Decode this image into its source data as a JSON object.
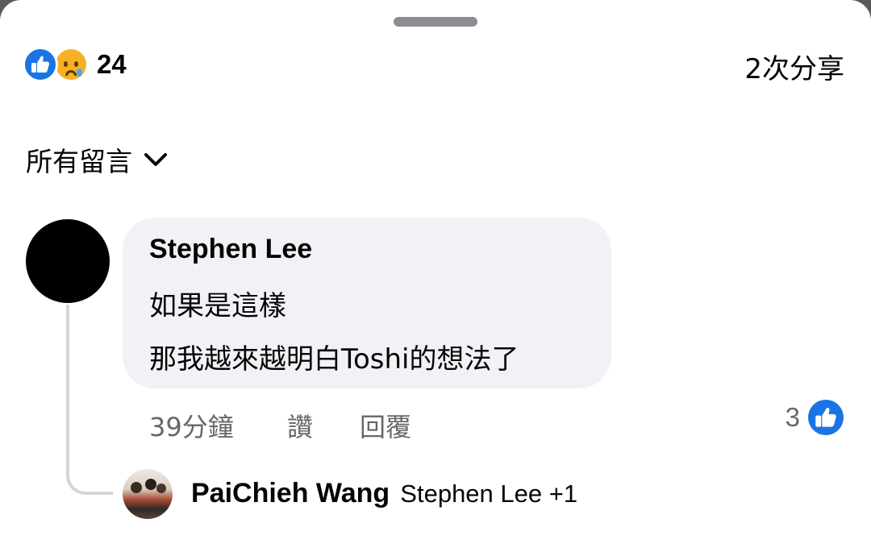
{
  "header": {
    "reaction_icons": [
      "like-icon",
      "sad-icon"
    ],
    "reaction_count": "24",
    "shares": "2次分享"
  },
  "filter": {
    "label": "所有留言",
    "icon": "chevron-down-icon"
  },
  "comment": {
    "author": "Stephen Lee",
    "lines": [
      "如果是這樣",
      "那我越來越明白Toshi的想法了"
    ],
    "time": "39分鐘",
    "like_action": "讚",
    "reply_action": "回覆",
    "like_count": "3",
    "colors": {
      "bubble": "#f0f2f5",
      "like_blue": "#1b74e4",
      "meta_gray": "#65676b"
    }
  },
  "reply": {
    "author": "PaiChieh Wang",
    "preview": "Stephen Lee +1"
  }
}
